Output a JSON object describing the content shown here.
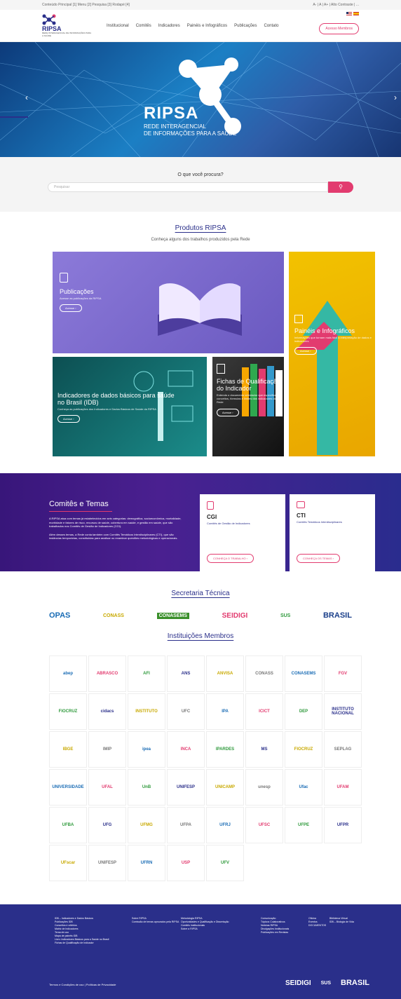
{
  "topbar": {
    "left": "Conteúdo Principal [1]  Menu [2]  Pesquisa [3]  Rodapé [4]",
    "right": "A- | A | A+ | Alto Contraste | ..."
  },
  "header": {
    "logo": "RIPSA",
    "logo_sub": "REDE INTERAGENCIAL DE INFORMAÇÕES PARA A SAÚDE",
    "nav": [
      "Institucional",
      "Comitês",
      "Indicadores",
      "Painéis e Infográficos",
      "Publicações",
      "Contato"
    ],
    "access_button": "Acesso Membros"
  },
  "hero": {
    "title": "RIPSA",
    "subtitle_1": "REDE INTERAGENCIAL",
    "subtitle_2": "DE INFORMAÇÕES PARA A SAÚDE"
  },
  "search": {
    "title": "O que você procura?",
    "placeholder": "Pesquisar"
  },
  "products": {
    "title": "Produtos RIPSA",
    "subtitle": "Conheça alguns dos trabalhos produzidos pela Rede",
    "cards": [
      {
        "title": "Publicações",
        "desc": "Acesse as publicações da RIPSA",
        "button": "Acesse"
      },
      {
        "title": "Painéis e Infográficos",
        "desc": "Informações que tornam mais fácil a interpretação de dados e indicadores",
        "button": "Acesse"
      },
      {
        "title": "Indicadores de dados básicos para saúde no Brasil (IDB)",
        "desc": "Conheça as publicações dos Indicadores e Dados Básicos de Saúde da RIPSA",
        "button": "Acesse"
      },
      {
        "title": "Fichas de Qualificação do Indicador",
        "desc": "Entenda o documento orientador que especifica conceitos, fórmulas e limites dos indicadores da Rede",
        "button": "Acesse"
      }
    ]
  },
  "committees": {
    "title": "Comitês e Temas",
    "text_1": "A RIPSA atua com temas já estabelecidos em seis categorias: demográfica, socioeconômica, mortalidade, morbidade e fatores de risco, recursos de saúde, cobertura em saúde, e gestão em saúde, que são trabalhados nos Comitês de Gestão de Indicadores (CGI).",
    "text_2": "Além desses temas, a Rede conta também com Comitês Temáticos Interdisciplinares (CTI), que são instâncias temporárias, constituídas para analisar ou examinar questões metodológicas e operacionais.",
    "boxes": [
      {
        "title": "CGI",
        "desc": "Comitês de Gestão de Indicadores",
        "button": "CONHEÇA O TRABALHO"
      },
      {
        "title": "CTI",
        "desc": "Comitês Temáticos Interdisciplinares",
        "button": "CONHEÇA OS TEMAS"
      }
    ]
  },
  "secretariat": {
    "title": "Secretaria Técnica",
    "logos": [
      "OPAS",
      "CONASS",
      "CONASEMS",
      "SEIDIGI",
      "SUS",
      "BRASIL"
    ]
  },
  "members": {
    "title": "Instituições Membros",
    "logos": [
      "abep",
      "ABRASCO",
      "AFI",
      "ANS",
      "ANVISA",
      "CONASS",
      "CONASEMS",
      "FGV",
      "FIOCRUZ",
      "cidacs",
      "INSTITUTO",
      "UFC",
      "IPA",
      "ICICT",
      "DEP",
      "INSTITUTO NACIONAL",
      "IBGE",
      "IMIP",
      "ipea",
      "INCA",
      "IPARDES",
      "MS",
      "FIOCRUZ",
      "SEPLAG",
      "UNIVERSIDADE",
      "UFAL",
      "UnB",
      "UNIFESP",
      "UNICAMP",
      "unesp",
      "Ufac",
      "UFAM",
      "UFBA",
      "UFG",
      "UFMG",
      "UFPA",
      "UFRJ",
      "UFSC",
      "UFPE",
      "UFPR",
      "UFscar",
      "UNIFESP",
      "UFRN",
      "USP",
      "UFV"
    ]
  },
  "footer": {
    "col1": [
      "IDB – Indicadores e Dados Básicos",
      "Publicações IDB",
      "Conceitos e critérios",
      "Matriz de Indicadores",
      "Tema de uso",
      "Mapa de painéis IDB",
      "Livro: Indicadores Básicos para a Saúde no Brasil",
      "Fichas de Qualificação de Indicador"
    ],
    "col2": [
      "Sobre RIPSA",
      "Comissão de temas aprovados pela RIPSA"
    ],
    "col3": [
      "Metodologia RIPSA",
      "Oportunidades e Qualificação e Dissertação",
      "Comitês Institucionais",
      "Sobre a RIPSA"
    ],
    "col4": [
      "Comunicação",
      "Tópicos Colaborativos",
      "Notícias RIPSA",
      "Divulgações Institucionais",
      "Publicações em Revistas"
    ],
    "col5": [
      "Oficina",
      "Eventos",
      "DOCUMENTOS"
    ],
    "col6": [
      "Biblioteca Virtual",
      "IDB – Biologia de Vida"
    ],
    "bottom": "Termos e Condições de uso | Políticas de Privacidade",
    "logos": [
      "SEIDIGI",
      "SUS",
      "BRASIL"
    ]
  }
}
